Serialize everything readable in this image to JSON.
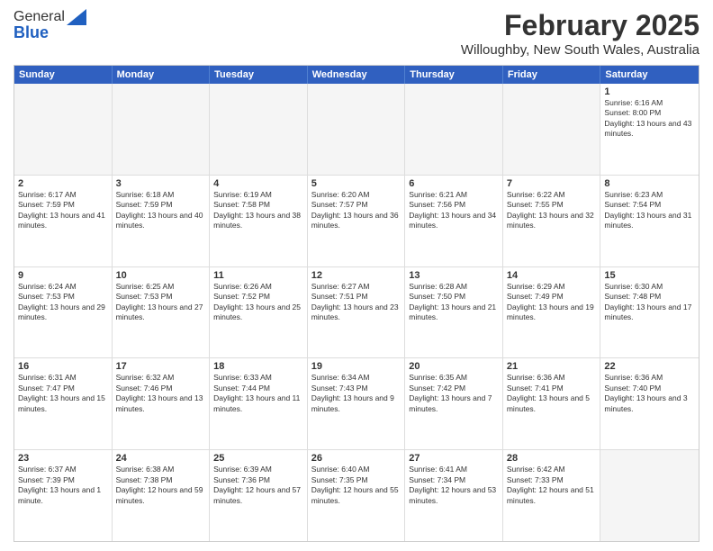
{
  "header": {
    "logo_general": "General",
    "logo_blue": "Blue",
    "title": "February 2025",
    "subtitle": "Willoughby, New South Wales, Australia"
  },
  "days_of_week": [
    "Sunday",
    "Monday",
    "Tuesday",
    "Wednesday",
    "Thursday",
    "Friday",
    "Saturday"
  ],
  "rows": [
    [
      {
        "day": "",
        "info": ""
      },
      {
        "day": "",
        "info": ""
      },
      {
        "day": "",
        "info": ""
      },
      {
        "day": "",
        "info": ""
      },
      {
        "day": "",
        "info": ""
      },
      {
        "day": "",
        "info": ""
      },
      {
        "day": "1",
        "info": "Sunrise: 6:16 AM\nSunset: 8:00 PM\nDaylight: 13 hours and 43 minutes."
      }
    ],
    [
      {
        "day": "2",
        "info": "Sunrise: 6:17 AM\nSunset: 7:59 PM\nDaylight: 13 hours and 41 minutes."
      },
      {
        "day": "3",
        "info": "Sunrise: 6:18 AM\nSunset: 7:59 PM\nDaylight: 13 hours and 40 minutes."
      },
      {
        "day": "4",
        "info": "Sunrise: 6:19 AM\nSunset: 7:58 PM\nDaylight: 13 hours and 38 minutes."
      },
      {
        "day": "5",
        "info": "Sunrise: 6:20 AM\nSunset: 7:57 PM\nDaylight: 13 hours and 36 minutes."
      },
      {
        "day": "6",
        "info": "Sunrise: 6:21 AM\nSunset: 7:56 PM\nDaylight: 13 hours and 34 minutes."
      },
      {
        "day": "7",
        "info": "Sunrise: 6:22 AM\nSunset: 7:55 PM\nDaylight: 13 hours and 32 minutes."
      },
      {
        "day": "8",
        "info": "Sunrise: 6:23 AM\nSunset: 7:54 PM\nDaylight: 13 hours and 31 minutes."
      }
    ],
    [
      {
        "day": "9",
        "info": "Sunrise: 6:24 AM\nSunset: 7:53 PM\nDaylight: 13 hours and 29 minutes."
      },
      {
        "day": "10",
        "info": "Sunrise: 6:25 AM\nSunset: 7:53 PM\nDaylight: 13 hours and 27 minutes."
      },
      {
        "day": "11",
        "info": "Sunrise: 6:26 AM\nSunset: 7:52 PM\nDaylight: 13 hours and 25 minutes."
      },
      {
        "day": "12",
        "info": "Sunrise: 6:27 AM\nSunset: 7:51 PM\nDaylight: 13 hours and 23 minutes."
      },
      {
        "day": "13",
        "info": "Sunrise: 6:28 AM\nSunset: 7:50 PM\nDaylight: 13 hours and 21 minutes."
      },
      {
        "day": "14",
        "info": "Sunrise: 6:29 AM\nSunset: 7:49 PM\nDaylight: 13 hours and 19 minutes."
      },
      {
        "day": "15",
        "info": "Sunrise: 6:30 AM\nSunset: 7:48 PM\nDaylight: 13 hours and 17 minutes."
      }
    ],
    [
      {
        "day": "16",
        "info": "Sunrise: 6:31 AM\nSunset: 7:47 PM\nDaylight: 13 hours and 15 minutes."
      },
      {
        "day": "17",
        "info": "Sunrise: 6:32 AM\nSunset: 7:46 PM\nDaylight: 13 hours and 13 minutes."
      },
      {
        "day": "18",
        "info": "Sunrise: 6:33 AM\nSunset: 7:44 PM\nDaylight: 13 hours and 11 minutes."
      },
      {
        "day": "19",
        "info": "Sunrise: 6:34 AM\nSunset: 7:43 PM\nDaylight: 13 hours and 9 minutes."
      },
      {
        "day": "20",
        "info": "Sunrise: 6:35 AM\nSunset: 7:42 PM\nDaylight: 13 hours and 7 minutes."
      },
      {
        "day": "21",
        "info": "Sunrise: 6:36 AM\nSunset: 7:41 PM\nDaylight: 13 hours and 5 minutes."
      },
      {
        "day": "22",
        "info": "Sunrise: 6:36 AM\nSunset: 7:40 PM\nDaylight: 13 hours and 3 minutes."
      }
    ],
    [
      {
        "day": "23",
        "info": "Sunrise: 6:37 AM\nSunset: 7:39 PM\nDaylight: 13 hours and 1 minute."
      },
      {
        "day": "24",
        "info": "Sunrise: 6:38 AM\nSunset: 7:38 PM\nDaylight: 12 hours and 59 minutes."
      },
      {
        "day": "25",
        "info": "Sunrise: 6:39 AM\nSunset: 7:36 PM\nDaylight: 12 hours and 57 minutes."
      },
      {
        "day": "26",
        "info": "Sunrise: 6:40 AM\nSunset: 7:35 PM\nDaylight: 12 hours and 55 minutes."
      },
      {
        "day": "27",
        "info": "Sunrise: 6:41 AM\nSunset: 7:34 PM\nDaylight: 12 hours and 53 minutes."
      },
      {
        "day": "28",
        "info": "Sunrise: 6:42 AM\nSunset: 7:33 PM\nDaylight: 12 hours and 51 minutes."
      },
      {
        "day": "",
        "info": ""
      }
    ]
  ]
}
